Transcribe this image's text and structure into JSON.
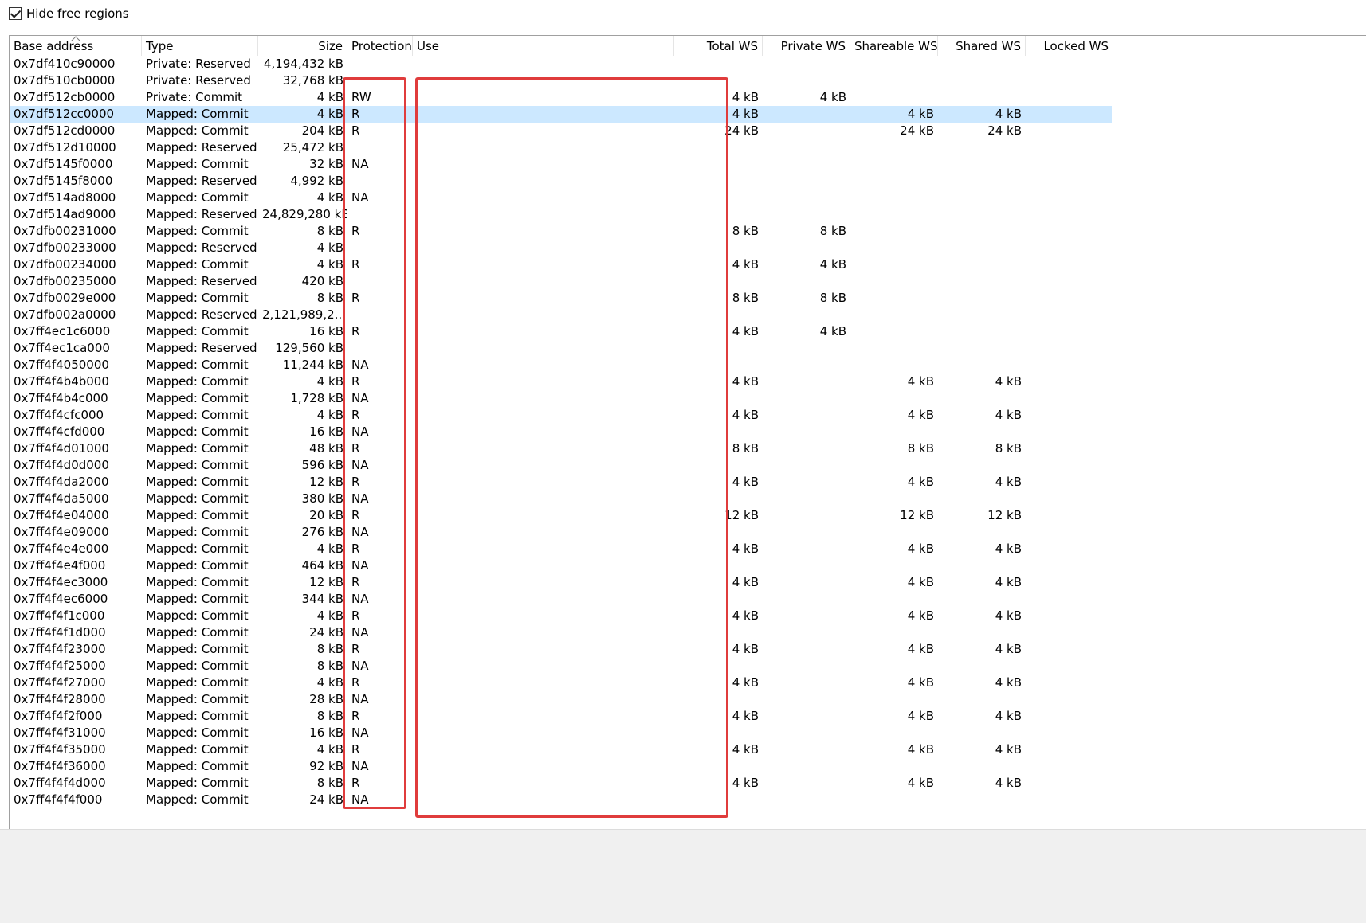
{
  "options": {
    "hide_free_label": "Hide free regions",
    "hide_free_checked": true
  },
  "columns": {
    "base": "Base address",
    "type": "Type",
    "size": "Size",
    "prot": "Protection",
    "use": "Use",
    "tws": "Total WS",
    "pws": "Private WS",
    "shws": "Shareable WS",
    "sdws": "Shared WS",
    "lws": "Locked WS"
  },
  "rows": [
    [
      "0x7df410c90000",
      "Private: Reserved",
      "4,194,432 kB",
      "",
      "",
      "",
      "",
      "",
      "",
      ""
    ],
    [
      "0x7df510cb0000",
      "Private: Reserved",
      "32,768 kB",
      "",
      "",
      "",
      "",
      "",
      "",
      ""
    ],
    [
      "0x7df512cb0000",
      "Private: Commit",
      "4 kB",
      "RW",
      "",
      "4 kB",
      "4 kB",
      "",
      "",
      ""
    ],
    [
      "0x7df512cc0000",
      "Mapped: Commit",
      "4 kB",
      "R",
      "",
      "4 kB",
      "",
      "4 kB",
      "4 kB",
      ""
    ],
    [
      "0x7df512cd0000",
      "Mapped: Commit",
      "204 kB",
      "R",
      "",
      "24 kB",
      "",
      "24 kB",
      "24 kB",
      ""
    ],
    [
      "0x7df512d10000",
      "Mapped: Reserved",
      "25,472 kB",
      "",
      "",
      "",
      "",
      "",
      "",
      ""
    ],
    [
      "0x7df5145f0000",
      "Mapped: Commit",
      "32 kB",
      "NA",
      "",
      "",
      "",
      "",
      "",
      ""
    ],
    [
      "0x7df5145f8000",
      "Mapped: Reserved",
      "4,992 kB",
      "",
      "",
      "",
      "",
      "",
      "",
      ""
    ],
    [
      "0x7df514ad8000",
      "Mapped: Commit",
      "4 kB",
      "NA",
      "",
      "",
      "",
      "",
      "",
      ""
    ],
    [
      "0x7df514ad9000",
      "Mapped: Reserved",
      "24,829,280 kB",
      "",
      "",
      "",
      "",
      "",
      "",
      ""
    ],
    [
      "0x7dfb00231000",
      "Mapped: Commit",
      "8 kB",
      "R",
      "",
      "8 kB",
      "8 kB",
      "",
      "",
      ""
    ],
    [
      "0x7dfb00233000",
      "Mapped: Reserved",
      "4 kB",
      "",
      "",
      "",
      "",
      "",
      "",
      ""
    ],
    [
      "0x7dfb00234000",
      "Mapped: Commit",
      "4 kB",
      "R",
      "",
      "4 kB",
      "4 kB",
      "",
      "",
      ""
    ],
    [
      "0x7dfb00235000",
      "Mapped: Reserved",
      "420 kB",
      "",
      "",
      "",
      "",
      "",
      "",
      ""
    ],
    [
      "0x7dfb0029e000",
      "Mapped: Commit",
      "8 kB",
      "R",
      "",
      "8 kB",
      "8 kB",
      "",
      "",
      ""
    ],
    [
      "0x7dfb002a0000",
      "Mapped: Reserved",
      "2,121,989,2...",
      "",
      "",
      "",
      "",
      "",
      "",
      ""
    ],
    [
      "0x7ff4ec1c6000",
      "Mapped: Commit",
      "16 kB",
      "R",
      "",
      "4 kB",
      "4 kB",
      "",
      "",
      ""
    ],
    [
      "0x7ff4ec1ca000",
      "Mapped: Reserved",
      "129,560 kB",
      "",
      "",
      "",
      "",
      "",
      "",
      ""
    ],
    [
      "0x7ff4f4050000",
      "Mapped: Commit",
      "11,244 kB",
      "NA",
      "",
      "",
      "",
      "",
      "",
      ""
    ],
    [
      "0x7ff4f4b4b000",
      "Mapped: Commit",
      "4 kB",
      "R",
      "",
      "4 kB",
      "",
      "4 kB",
      "4 kB",
      ""
    ],
    [
      "0x7ff4f4b4c000",
      "Mapped: Commit",
      "1,728 kB",
      "NA",
      "",
      "",
      "",
      "",
      "",
      ""
    ],
    [
      "0x7ff4f4cfc000",
      "Mapped: Commit",
      "4 kB",
      "R",
      "",
      "4 kB",
      "",
      "4 kB",
      "4 kB",
      ""
    ],
    [
      "0x7ff4f4cfd000",
      "Mapped: Commit",
      "16 kB",
      "NA",
      "",
      "",
      "",
      "",
      "",
      ""
    ],
    [
      "0x7ff4f4d01000",
      "Mapped: Commit",
      "48 kB",
      "R",
      "",
      "8 kB",
      "",
      "8 kB",
      "8 kB",
      ""
    ],
    [
      "0x7ff4f4d0d000",
      "Mapped: Commit",
      "596 kB",
      "NA",
      "",
      "",
      "",
      "",
      "",
      ""
    ],
    [
      "0x7ff4f4da2000",
      "Mapped: Commit",
      "12 kB",
      "R",
      "",
      "4 kB",
      "",
      "4 kB",
      "4 kB",
      ""
    ],
    [
      "0x7ff4f4da5000",
      "Mapped: Commit",
      "380 kB",
      "NA",
      "",
      "",
      "",
      "",
      "",
      ""
    ],
    [
      "0x7ff4f4e04000",
      "Mapped: Commit",
      "20 kB",
      "R",
      "",
      "12 kB",
      "",
      "12 kB",
      "12 kB",
      ""
    ],
    [
      "0x7ff4f4e09000",
      "Mapped: Commit",
      "276 kB",
      "NA",
      "",
      "",
      "",
      "",
      "",
      ""
    ],
    [
      "0x7ff4f4e4e000",
      "Mapped: Commit",
      "4 kB",
      "R",
      "",
      "4 kB",
      "",
      "4 kB",
      "4 kB",
      ""
    ],
    [
      "0x7ff4f4e4f000",
      "Mapped: Commit",
      "464 kB",
      "NA",
      "",
      "",
      "",
      "",
      "",
      ""
    ],
    [
      "0x7ff4f4ec3000",
      "Mapped: Commit",
      "12 kB",
      "R",
      "",
      "4 kB",
      "",
      "4 kB",
      "4 kB",
      ""
    ],
    [
      "0x7ff4f4ec6000",
      "Mapped: Commit",
      "344 kB",
      "NA",
      "",
      "",
      "",
      "",
      "",
      ""
    ],
    [
      "0x7ff4f4f1c000",
      "Mapped: Commit",
      "4 kB",
      "R",
      "",
      "4 kB",
      "",
      "4 kB",
      "4 kB",
      ""
    ],
    [
      "0x7ff4f4f1d000",
      "Mapped: Commit",
      "24 kB",
      "NA",
      "",
      "",
      "",
      "",
      "",
      ""
    ],
    [
      "0x7ff4f4f23000",
      "Mapped: Commit",
      "8 kB",
      "R",
      "",
      "4 kB",
      "",
      "4 kB",
      "4 kB",
      ""
    ],
    [
      "0x7ff4f4f25000",
      "Mapped: Commit",
      "8 kB",
      "NA",
      "",
      "",
      "",
      "",
      "",
      ""
    ],
    [
      "0x7ff4f4f27000",
      "Mapped: Commit",
      "4 kB",
      "R",
      "",
      "4 kB",
      "",
      "4 kB",
      "4 kB",
      ""
    ],
    [
      "0x7ff4f4f28000",
      "Mapped: Commit",
      "28 kB",
      "NA",
      "",
      "",
      "",
      "",
      "",
      ""
    ],
    [
      "0x7ff4f4f2f000",
      "Mapped: Commit",
      "8 kB",
      "R",
      "",
      "4 kB",
      "",
      "4 kB",
      "4 kB",
      ""
    ],
    [
      "0x7ff4f4f31000",
      "Mapped: Commit",
      "16 kB",
      "NA",
      "",
      "",
      "",
      "",
      "",
      ""
    ],
    [
      "0x7ff4f4f35000",
      "Mapped: Commit",
      "4 kB",
      "R",
      "",
      "4 kB",
      "",
      "4 kB",
      "4 kB",
      ""
    ],
    [
      "0x7ff4f4f36000",
      "Mapped: Commit",
      "92 kB",
      "NA",
      "",
      "",
      "",
      "",
      "",
      ""
    ],
    [
      "0x7ff4f4f4d000",
      "Mapped: Commit",
      "8 kB",
      "R",
      "",
      "4 kB",
      "",
      "4 kB",
      "4 kB",
      ""
    ],
    [
      "0x7ff4f4f4f000",
      "Mapped: Commit",
      "24 kB",
      "NA",
      "",
      "",
      "",
      "",
      "",
      ""
    ]
  ],
  "selected_row": 3,
  "colors": {
    "selection": "#cce8ff",
    "annotation": "#e03c3c"
  }
}
